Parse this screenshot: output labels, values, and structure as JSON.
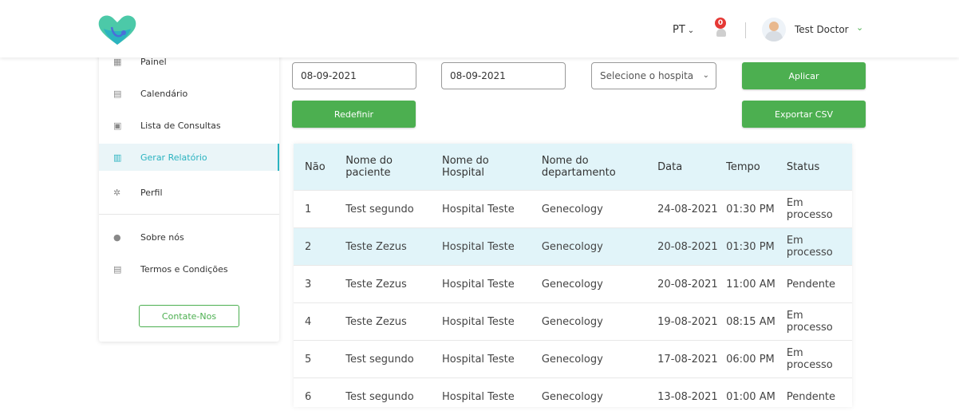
{
  "header": {
    "language": "PT",
    "notification_count": "0",
    "user_name": "Test Doctor"
  },
  "sidebar": {
    "items": [
      {
        "label": "Painel",
        "icon": "dashboard-icon"
      },
      {
        "label": "Calendário",
        "icon": "calendar-icon"
      },
      {
        "label": "Lista de Consultas",
        "icon": "list-icon"
      },
      {
        "label": "Gerar Relatório",
        "icon": "report-icon",
        "active": true
      },
      {
        "label": "Perfil",
        "icon": "gear-icon"
      },
      {
        "label": "Sobre nós",
        "icon": "info-icon"
      },
      {
        "label": "Termos e Condições",
        "icon": "document-icon"
      }
    ],
    "contact_label": "Contate-Nos"
  },
  "filters": {
    "start_date": "08-09-2021",
    "end_date": "08-09-2021",
    "hospital_placeholder": "Selecione o hospita",
    "apply_label": "Aplicar",
    "reset_label": "Redefinir",
    "export_label": "Exportar CSV"
  },
  "table": {
    "headers": [
      "Não",
      "Nome do paciente",
      "Nome do Hospital",
      "Nome do departamento",
      "Data",
      "Tempo",
      "Status"
    ],
    "rows": [
      [
        "1",
        "Test segundo",
        "Hospital Teste",
        "Genecology",
        "24-08-2021",
        "01:30 PM",
        "Em processo"
      ],
      [
        "2",
        "Teste Zezus",
        "Hospital Teste",
        "Genecology",
        "20-08-2021",
        "01:30 PM",
        "Em processo"
      ],
      [
        "3",
        "Teste Zezus",
        "Hospital Teste",
        "Genecology",
        "20-08-2021",
        "11:00 AM",
        "Pendente"
      ],
      [
        "4",
        "Teste Zezus",
        "Hospital Teste",
        "Genecology",
        "19-08-2021",
        "08:15 AM",
        "Em processo"
      ],
      [
        "5",
        "Test segundo",
        "Hospital Teste",
        "Genecology",
        "17-08-2021",
        "06:00 PM",
        "Em processo"
      ],
      [
        "6",
        "Test segundo",
        "Hospital Teste",
        "Genecology",
        "13-08-2021",
        "01:00 AM",
        "Pendente"
      ]
    ]
  },
  "colors": {
    "accent": "#4caf50",
    "active_nav": "#2bb3c0",
    "table_header_bg": "#e1f4f9",
    "badge": "#e53935"
  }
}
